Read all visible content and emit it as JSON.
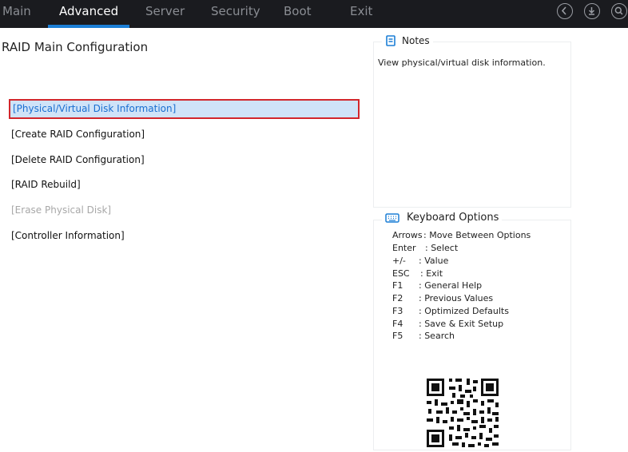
{
  "tabs": [
    {
      "label": "Main",
      "active": false
    },
    {
      "label": "Advanced",
      "active": true
    },
    {
      "label": "Server",
      "active": false
    },
    {
      "label": "Security",
      "active": false
    },
    {
      "label": "Boot",
      "active": false
    },
    {
      "label": "Exit",
      "active": false
    }
  ],
  "toolbar_icons": [
    "back-icon",
    "download-icon",
    "search-icon"
  ],
  "page_title": "RAID Main Configuration",
  "menu_items": [
    {
      "label": "[Physical/Virtual Disk Information]",
      "state": "selected"
    },
    {
      "label": "[Create RAID Configuration]",
      "state": "normal"
    },
    {
      "label": "[Delete RAID Configuration]",
      "state": "normal"
    },
    {
      "label": "[RAID Rebuild]",
      "state": "normal"
    },
    {
      "label": "[Erase Physical Disk]",
      "state": "disabled"
    },
    {
      "label": "[Controller Information]",
      "state": "normal"
    }
  ],
  "notes": {
    "title": "Notes",
    "text": "View physical/virtual disk information."
  },
  "keyboard": {
    "title": "Keyboard Options",
    "options": [
      {
        "key": "Arrows",
        "desc": ": Move Between Options"
      },
      {
        "key": "Enter",
        "desc": ": Select"
      },
      {
        "key": "+/-",
        "desc": ": Value"
      },
      {
        "key": "ESC",
        "desc": ": Exit"
      },
      {
        "key": "F1",
        "desc": ": General Help"
      },
      {
        "key": "F2",
        "desc": ": Previous Values"
      },
      {
        "key": "F3",
        "desc": ": Optimized Defaults"
      },
      {
        "key": "F4",
        "desc": ": Save & Exit Setup"
      },
      {
        "key": "F5",
        "desc": ": Search"
      }
    ]
  },
  "colors": {
    "topbar": "#1a1b1f",
    "accent": "#1c7fd6",
    "selection_border": "#d2262c",
    "selection_bg": "#cfe3f8",
    "disabled_text": "#a8a8a8"
  }
}
